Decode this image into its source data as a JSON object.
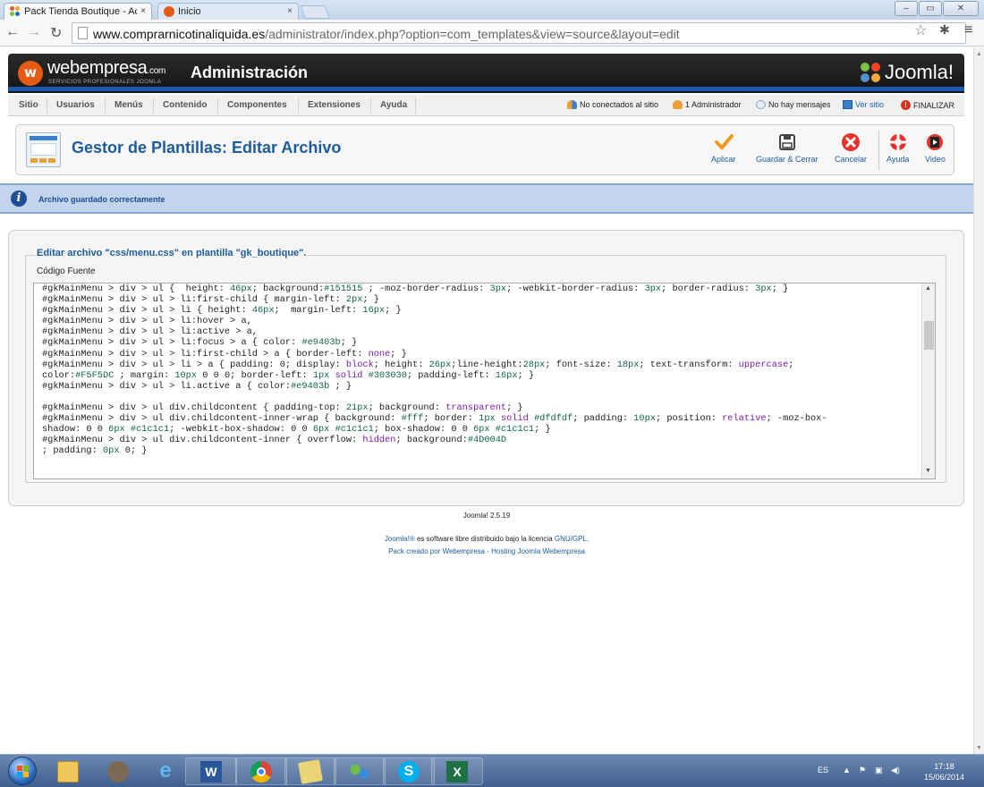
{
  "browser": {
    "tabs": [
      {
        "title": "Pack Tienda Boutique - Ac",
        "close": "×"
      },
      {
        "title": "Inicio",
        "close": "×"
      }
    ],
    "url_domain": "www.comprarnicotinaliquida.es",
    "url_path": "/administrator/index.php?option=com_templates&view=source&layout=edit",
    "window_buttons": [
      "–",
      "▭",
      "✕"
    ]
  },
  "header": {
    "brand": "webempresa",
    "brand_suffix": ".com",
    "brand_sub": "SERVICIOS PROFESIONALES JOOMLA",
    "admin_title": "Administración",
    "joomla_logo": "Joomla!"
  },
  "menubar": {
    "items": [
      "Sitio",
      "Usuarios",
      "Menús",
      "Contenido",
      "Componentes",
      "Extensiones",
      "Ayuda"
    ],
    "status": {
      "not_connected": "No conectados al sitio",
      "admins": "1 Administrador",
      "messages": "No hay mensajes",
      "view_site": "Ver sitio",
      "logout": "FINALIZAR"
    }
  },
  "toolbar": {
    "title": "Gestor de Plantillas: Editar Archivo",
    "buttons": {
      "apply": "Aplicar",
      "save_close": "Guardar & Cerrar",
      "cancel": "Cancelar",
      "help": "Ayuda",
      "video": "Video"
    }
  },
  "message": {
    "text": "Archivo guardado correctamente"
  },
  "editor": {
    "legend": "Editar archivo \"css/menu.css\" en plantilla \"gk_boutique\".",
    "source_label": "Código Fuente",
    "code_lines": [
      "#gkMainMenu > div > ul {  height: 46px; background:#151515 ; -moz-border-radius: 3px; -webkit-border-radius: 3px; border-radius: 3px; }",
      "#gkMainMenu > div > ul > li:first-child { margin-left: 2px; }",
      "#gkMainMenu > div > ul > li { height: 46px;  margin-left: 16px; }",
      "#gkMainMenu > div > ul > li:hover > a,",
      "#gkMainMenu > div > ul > li:active > a,",
      "#gkMainMenu > div > ul > li:focus > a { color: #e9403b; }",
      "#gkMainMenu > div > ul > li:first-child > a { border-left: none; }",
      "#gkMainMenu > div > ul > li > a { padding: 0; display: block; height: 26px;line-height:28px; font-size: 18px; text-transform: uppercase;",
      "color:#F5F5DC ; margin: 10px 0 0 0; border-left: 1px solid #303030; padding-left: 16px; }",
      "#gkMainMenu > div > ul > li.active a { color:#e9403b ; }",
      "",
      "#gkMainMenu > div > ul div.childcontent { padding-top: 21px; background: transparent; }",
      "#gkMainMenu > div > ul div.childcontent-inner-wrap { background: #fff; border: 1px solid #dfdfdf; padding: 10px; position: relative; -moz-box-",
      "shadow: 0 0 6px #c1c1c1; -webkit-box-shadow: 0 0 6px #c1c1c1; box-shadow: 0 0 6px #c1c1c1; }",
      "#gkMainMenu > div > ul div.childcontent-inner { overflow: hidden; background:#4D004D",
      "; padding: 0px 0; }"
    ]
  },
  "footer": {
    "version": "Joomla! 2.5.19",
    "license_brand": "Joomla!®",
    "license_text": " es software libre distribuido bajo la licencia ",
    "license_link": "GNU/GPL",
    "license_end": ".",
    "pack_text": "Pack creado por Webempresa - Hosting Joomla Webempresa"
  },
  "taskbar": {
    "lang": "ES",
    "time": "17:18",
    "date": "15/06/2014"
  },
  "colors": {
    "joomla_blue": "#1d5c9c",
    "header_dark": "#151515",
    "accent_orange": "#e55b13",
    "message_bg": "#c3d5ec"
  }
}
